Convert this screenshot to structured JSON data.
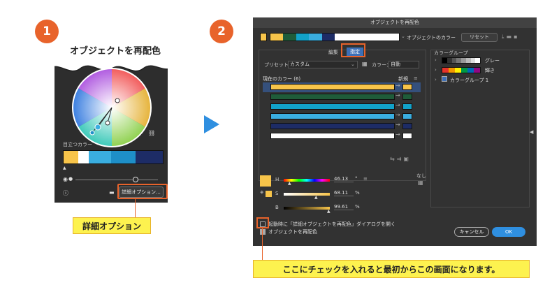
{
  "steps": {
    "one": "1",
    "two": "2"
  },
  "left": {
    "title": "オブジェクトを再配色",
    "prominent_label": "目立つカラー",
    "swatches": [
      "#f7c44a",
      "#ffffff",
      "#3aaee0",
      "#1e8fc8",
      "#1d2c66"
    ],
    "info_icon": "ⓘ",
    "advanced_button": "詳細オプション...",
    "callout": "詳細オプション"
  },
  "dialog": {
    "title": "オブジェクトを再配色",
    "object_colors_label": "オブジェクトのカラー",
    "reset_button": "リセット",
    "tab_edit": "編集",
    "tab_assign": "指定",
    "preset_label": "プリセット：",
    "preset_value": "カスタム",
    "colors_label": "カラー：",
    "colors_value": "自動",
    "current_colors": "現在のカラー (6)",
    "new_label": "新規",
    "rows": [
      {
        "a": "#f7c44a",
        "b": "#f7c44a"
      },
      {
        "a": "#1f5c3a",
        "b": "#1f5c3a"
      },
      {
        "a": "#12a2c9",
        "b": "#12a2c9"
      },
      {
        "a": "#3aaee0",
        "b": "#3aaee0"
      },
      {
        "a": "#1d2c66",
        "b": "#1d2c66"
      },
      {
        "a": "#ffffff",
        "b": "#ffffff"
      }
    ],
    "none_label": "なし",
    "h_label": "H",
    "h_value": "46.13",
    "h_unit": "°",
    "s_label": "S",
    "s_value": "68.11",
    "s_unit": "%",
    "b_label": "B",
    "b_value": "99.61",
    "b_unit": "%",
    "groups_head": "カラーグループ",
    "group1": "グレー",
    "group2": "輝き",
    "group3": "カラーグループ 1",
    "checkbox1": "起動時に「詳細オブジェクトを再配色」ダイアログを開く",
    "checkbox2": "オブジェクトを再配色",
    "cancel": "キャンセル",
    "ok": "OK"
  },
  "bottom_callout": "ここにチェックを入れると最初からこの画面になります。"
}
